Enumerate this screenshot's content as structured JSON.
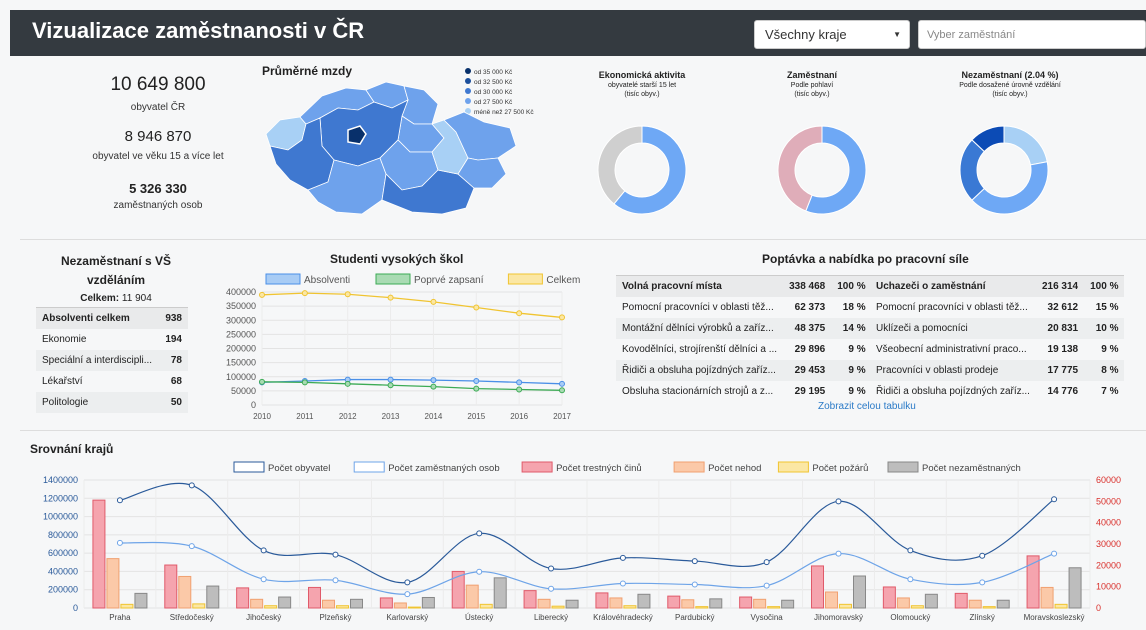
{
  "header": {
    "title": "Vizualizace zaměstnanosti v ČR",
    "region_select": "Všechny kraje",
    "job_placeholder": "Vyber zaměstnání"
  },
  "stats": {
    "population": "10 649 800",
    "population_label": "obyvatel ČR",
    "adults": "8 946 870",
    "adults_label": "obyvatel ve věku 15 a více let",
    "employed": "5 326 330",
    "employed_label": "zaměstnaných osob"
  },
  "wages": {
    "title": "Průměrné mzdy",
    "legend": [
      {
        "label": "od 35 000 Kč",
        "color": "#08306b"
      },
      {
        "label": "od 32 500 Kč",
        "color": "#1c4f9c"
      },
      {
        "label": "od 30 000 Kč",
        "color": "#3f78d0"
      },
      {
        "label": "od 27 500 Kč",
        "color": "#6ea2ec"
      },
      {
        "label": "méně než 27 500 Kč",
        "color": "#a8d0f5"
      }
    ]
  },
  "donuts": {
    "activity_title": "Ekonomická aktivita",
    "activity_sub1": "obyvatelé starší 15 let",
    "activity_sub2": "(tisíc obyv.)",
    "employed_title": "Zaměstnaní",
    "employed_sub1": "Podle pohlaví",
    "employed_sub2": "(tisíc obyv.)",
    "unemployed_title": "Nezaměstnaní (2.04 %)",
    "unemployed_sub1": "Podle dosažené úrovně vzdělání",
    "unemployed_sub2": "(tisíc obyv.)"
  },
  "grads": {
    "title1": "Nezaměstnaní s VŠ",
    "title2": "vzděláním",
    "total_label": "Celkem:",
    "total_value": "11 904",
    "rows": [
      {
        "label": "Absolventi celkem",
        "value": "938"
      },
      {
        "label": "Ekonomie",
        "value": "194"
      },
      {
        "label": "Speciální a interdiscipli...",
        "value": "78"
      },
      {
        "label": "Lékařství",
        "value": "68"
      },
      {
        "label": "Politologie",
        "value": "50"
      }
    ]
  },
  "students": {
    "title": "Studenti vysokých škol"
  },
  "supply": {
    "title": "Poptávka a nabídka po pracovní síle",
    "left_header": [
      "Volná pracovní místa",
      "338 468",
      "100 %"
    ],
    "left_rows": [
      [
        "Pomocní pracovníci v oblasti těž...",
        "62 373",
        "18 %"
      ],
      [
        "Montážní dělníci výrobků a zaříz...",
        "48 375",
        "14 %"
      ],
      [
        "Kovodělníci, strojírenští dělníci a ...",
        "29 896",
        "9 %"
      ],
      [
        "Řidiči a obsluha pojízdných zaříz...",
        "29 453",
        "9 %"
      ],
      [
        "Obsluha stacionárních strojů a z...",
        "29 195",
        "9 %"
      ]
    ],
    "right_header": [
      "Uchazeči o zaměstnání",
      "216 314",
      "100 %"
    ],
    "right_rows": [
      [
        "Pomocní pracovníci v oblasti těž...",
        "32 612",
        "15 %"
      ],
      [
        "Uklízeči a pomocníci",
        "20 831",
        "10 %"
      ],
      [
        "Všeobecní administrativní praco...",
        "19 138",
        "9 %"
      ],
      [
        "Pracovníci v oblasti prodeje",
        "17 775",
        "8 %"
      ],
      [
        "Řidiči a obsluha pojízdných zaříz...",
        "14 776",
        "7 %"
      ]
    ],
    "link": "Zobrazit celou tabulku"
  },
  "regions_title": "Srovnání krajů",
  "chart_data": [
    {
      "type": "pie",
      "title": "Ekonomická aktivita",
      "slices": [
        {
          "value": 0.61,
          "color": "#6ea8f5"
        },
        {
          "value": 0.39,
          "color": "#cfcfcf"
        }
      ]
    },
    {
      "type": "pie",
      "title": "Zaměstnaní",
      "slices": [
        {
          "value": 0.56,
          "color": "#6ea8f5"
        },
        {
          "value": 0.44,
          "color": "#dfadb9"
        }
      ]
    },
    {
      "type": "pie",
      "title": "Nezaměstnaní (2.04 %)",
      "slices": [
        {
          "value": 0.22,
          "color": "#a8d0f5"
        },
        {
          "value": 0.41,
          "color": "#6ea8f5"
        },
        {
          "value": 0.24,
          "color": "#3a79d4"
        },
        {
          "value": 0.13,
          "color": "#0c4bb5"
        }
      ]
    },
    {
      "type": "line",
      "title": "Studenti vysokých škol",
      "x": [
        2010,
        2011,
        2012,
        2013,
        2014,
        2015,
        2016,
        2017
      ],
      "ylim": [
        0,
        400000
      ],
      "yticks": [
        0,
        50000,
        100000,
        150000,
        200000,
        250000,
        300000,
        350000,
        400000
      ],
      "series": [
        {
          "name": "Absolventi",
          "color": "#4a8fe7",
          "fill": "#a8ccf5",
          "values": [
            80000,
            85000,
            90000,
            90000,
            88000,
            85000,
            80000,
            75000
          ]
        },
        {
          "name": "Poprvé zapsaní",
          "color": "#3cab55",
          "fill": "#a9dbb3",
          "values": [
            82000,
            80000,
            75000,
            70000,
            65000,
            58000,
            55000,
            52000
          ]
        },
        {
          "name": "Celkem",
          "color": "#f0c431",
          "fill": "#fbe7a4",
          "values": [
            390000,
            396000,
            392000,
            380000,
            365000,
            345000,
            325000,
            310000
          ]
        }
      ]
    },
    {
      "type": "bar",
      "title": "Srovnání krajů",
      "categories": [
        "Praha",
        "Středočeský",
        "Jihočeský",
        "Plzeňský",
        "Karlovarský",
        "Ústecký",
        "Liberecký",
        "Královéhradecký",
        "Pardubický",
        "Vysočina",
        "Jihomoravský",
        "Olomoucký",
        "Zlínský",
        "Moravskoslezský"
      ],
      "ylim_left": [
        0,
        1400000
      ],
      "yticks_left": [
        0,
        200000,
        400000,
        600000,
        800000,
        1000000,
        1200000,
        1400000
      ],
      "ylim_right": [
        0,
        60000
      ],
      "yticks_right": [
        0,
        10000,
        20000,
        30000,
        40000,
        50000,
        60000
      ],
      "line_series": [
        {
          "name": "Počet obyvatel",
          "color": "#2a5a9a",
          "axis": "right",
          "values": [
            50500,
            57500,
            27000,
            25000,
            12000,
            35000,
            18500,
            23500,
            22000,
            21500,
            50000,
            27000,
            24500,
            51000
          ]
        },
        {
          "name": "Počet zaměstnaných osob",
          "color": "#6ea4e8",
          "axis": "right",
          "values": [
            30500,
            29000,
            13500,
            13000,
            6500,
            17000,
            9000,
            11500,
            11000,
            10500,
            25500,
            13500,
            12000,
            25500
          ]
        }
      ],
      "bar_series": [
        {
          "name": "Počet trestných činů",
          "color": "#e05a6a",
          "fill": "#f5a4ae",
          "axis": "left",
          "values": [
            1180000,
            470000,
            220000,
            225000,
            110000,
            400000,
            190000,
            165000,
            130000,
            120000,
            460000,
            230000,
            160000,
            570000
          ]
        },
        {
          "name": "Počet nehod",
          "color": "#f0a070",
          "fill": "#fbc9a8",
          "axis": "left",
          "values": [
            540000,
            345000,
            95000,
            85000,
            55000,
            250000,
            95000,
            110000,
            90000,
            95000,
            175000,
            110000,
            85000,
            225000
          ]
        },
        {
          "name": "Počet požárů",
          "color": "#f0c431",
          "fill": "#fbe7a4",
          "axis": "left",
          "values": [
            40000,
            45000,
            25000,
            25000,
            10000,
            40000,
            20000,
            25000,
            15000,
            15000,
            40000,
            25000,
            15000,
            40000
          ]
        },
        {
          "name": "Počet nezaměstnaných",
          "color": "#888888",
          "fill": "#bdbdbd",
          "axis": "left",
          "values": [
            160000,
            240000,
            120000,
            95000,
            115000,
            330000,
            85000,
            150000,
            100000,
            85000,
            350000,
            150000,
            85000,
            440000
          ]
        }
      ]
    }
  ]
}
